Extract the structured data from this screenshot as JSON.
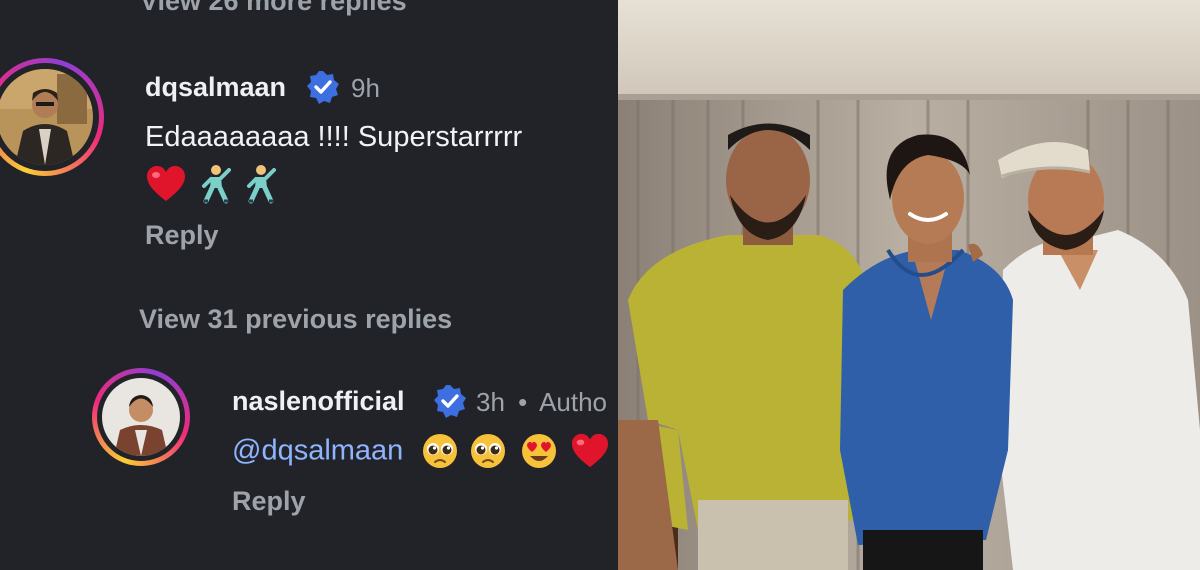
{
  "thread": {
    "view_more": "View 26 more replies",
    "view_previous": "View 31 previous replies"
  },
  "comment1": {
    "username": "dqsalmaan",
    "time": "9h",
    "text": "Edaaaaaaaa !!!! Superstarrrrr",
    "emojis": [
      "red-heart-emoji",
      "man-dancing-emoji",
      "man-dancing-emoji"
    ],
    "reply": "Reply"
  },
  "comment2": {
    "username": "naslenofficial",
    "time": "3h",
    "separator": "•",
    "badge": "Autho",
    "mention": "@dqsalmaan",
    "emojis": [
      "pleading-face-emoji",
      "pleading-face-emoji",
      "heart-eyes-emoji",
      "red-heart-emoji"
    ],
    "reply": "Reply"
  },
  "colors": {
    "background": "#212328",
    "mention": "#8fb4ff",
    "verified": "#3d6fe0"
  }
}
